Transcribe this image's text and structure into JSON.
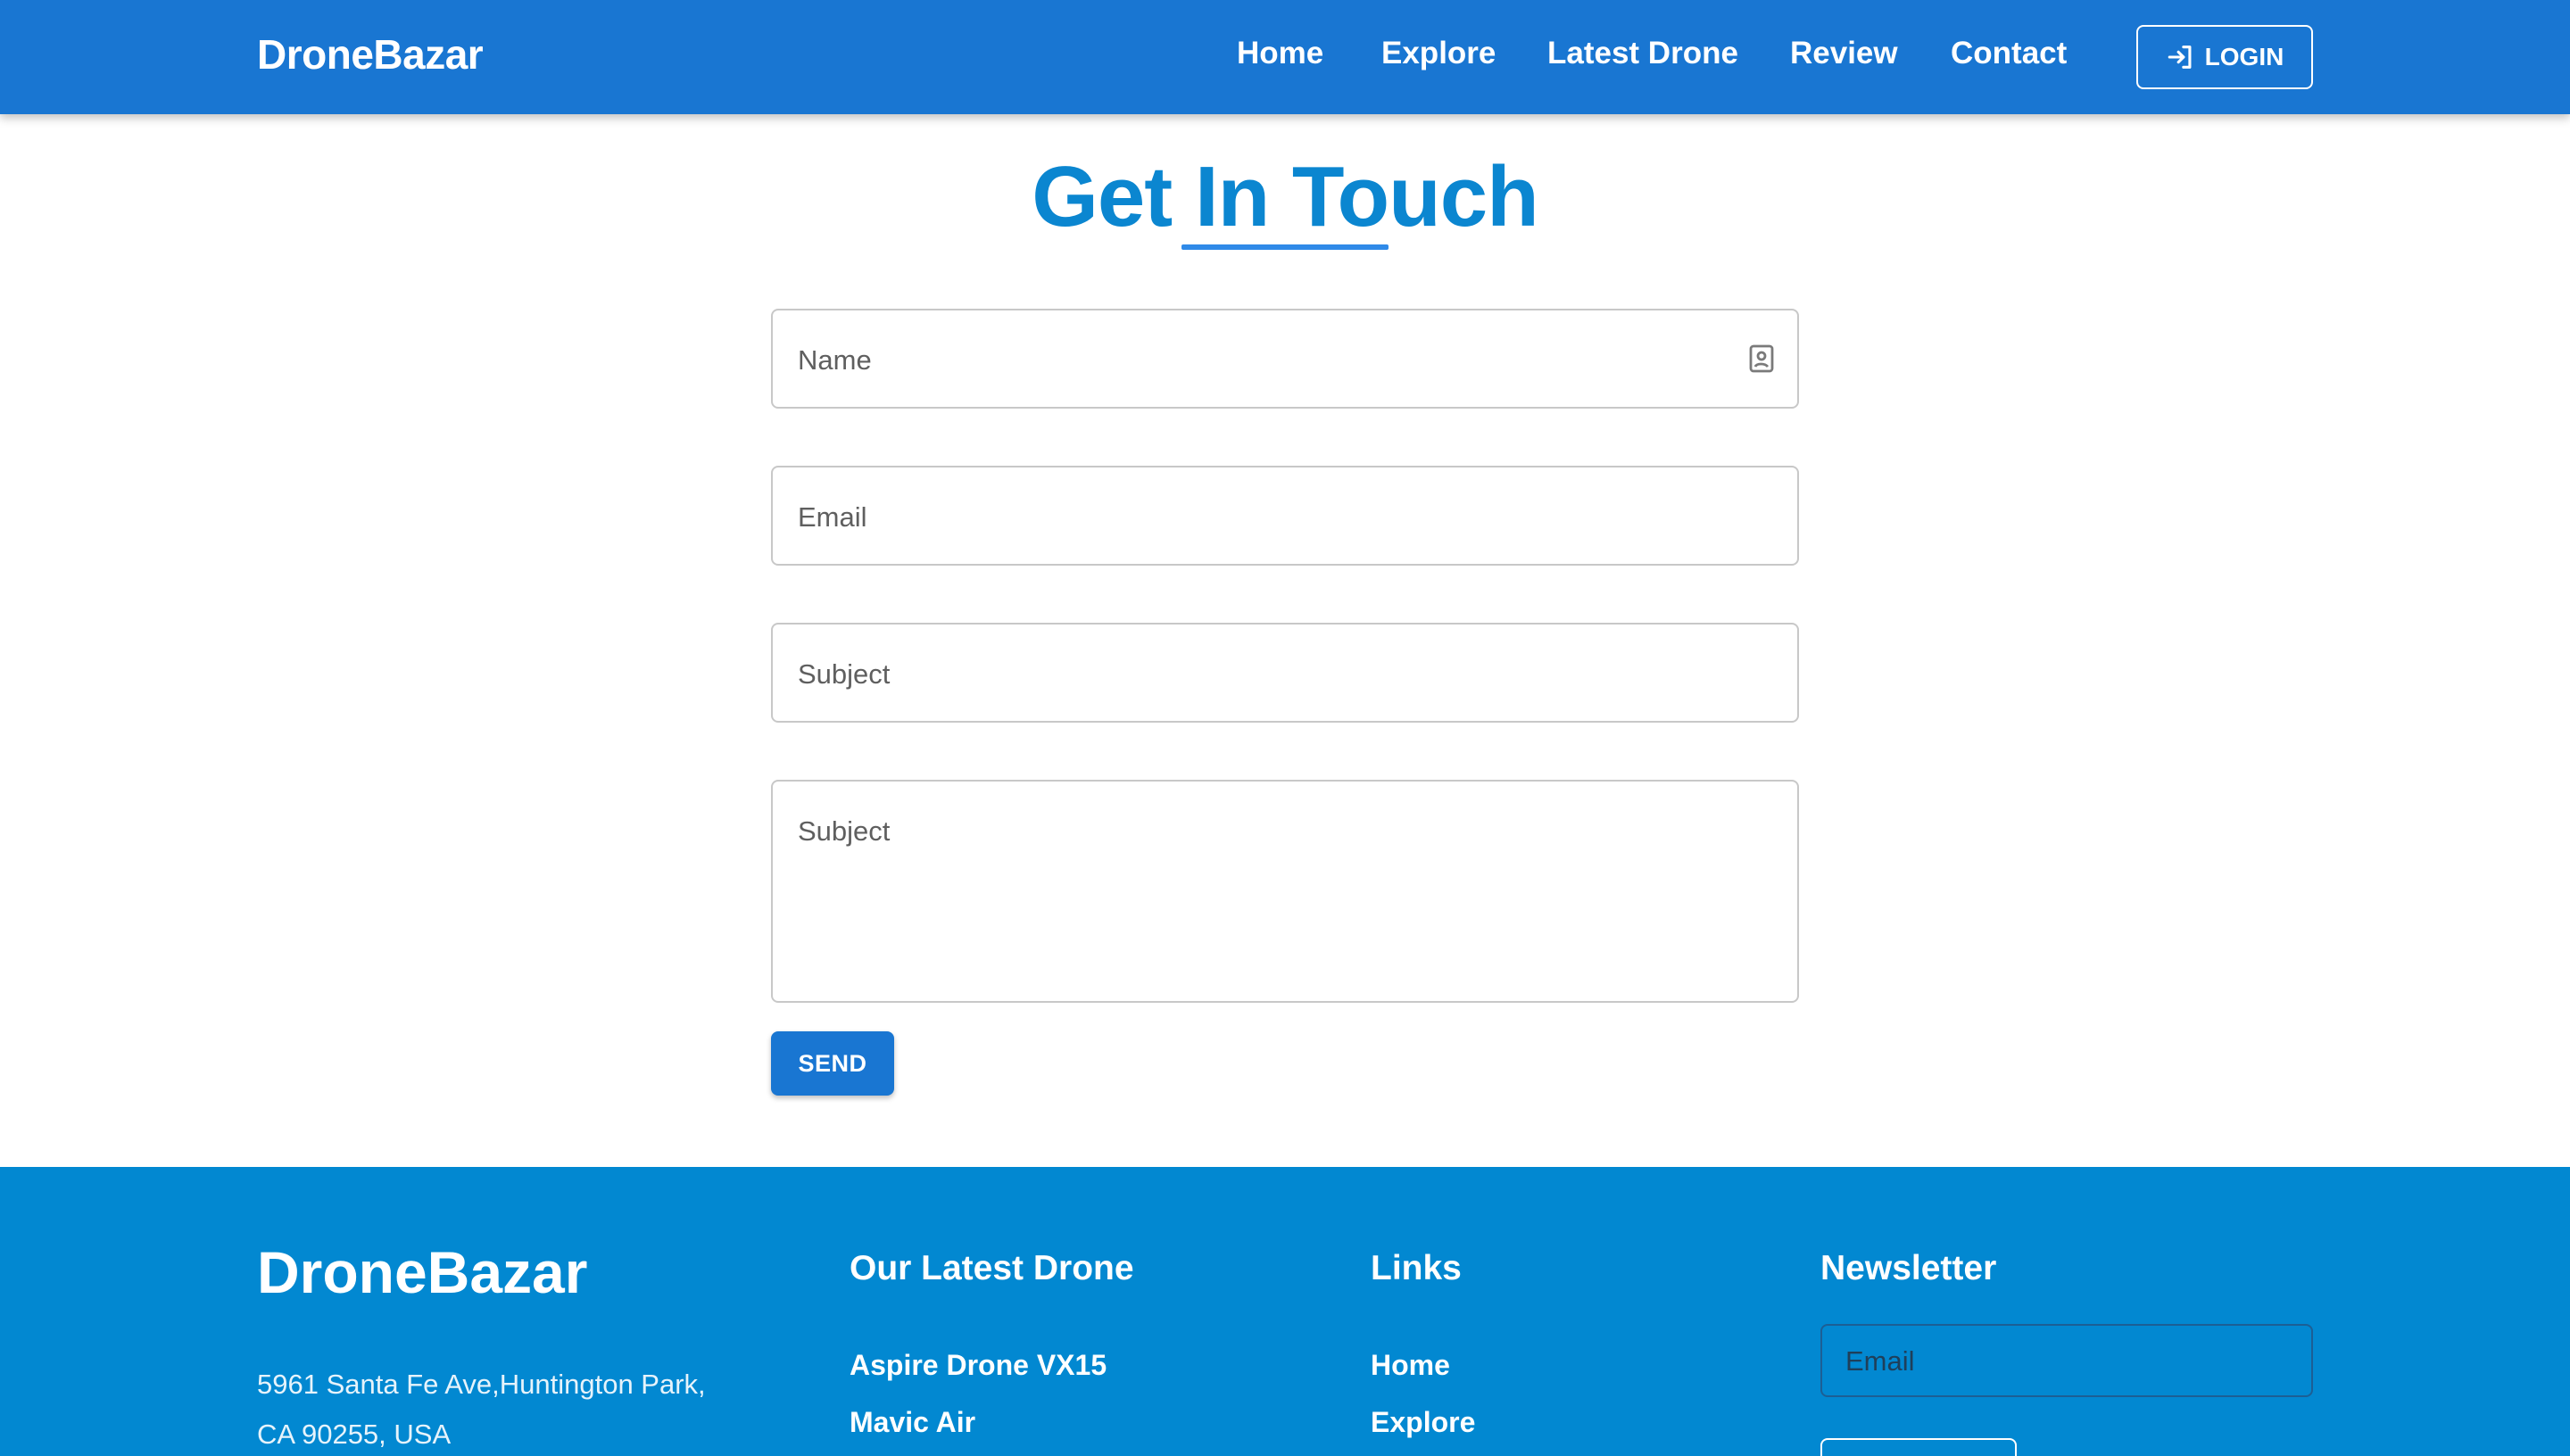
{
  "header": {
    "brand": "DroneBazar",
    "nav": [
      "Home",
      "Explore",
      "Latest Drone",
      "Review",
      "Contact"
    ],
    "login_label": "LOGIN"
  },
  "main": {
    "title": "Get In Touch",
    "form": {
      "name_label": "Name",
      "email_label": "Email",
      "subject_label": "Subject",
      "message_label": "Subject",
      "send_label": "SEND"
    }
  },
  "footer": {
    "brand": "DroneBazar",
    "address_line1": "5961 Santa Fe Ave,Huntington Park,",
    "address_line2": "CA 90255, USA",
    "latest_heading": "Our Latest Drone",
    "latest_items": [
      "Aspire Drone VX15",
      "Mavic Air"
    ],
    "links_heading": "Links",
    "links_items": [
      "Home",
      "Explore"
    ],
    "newsletter_heading": "Newsletter",
    "newsletter_placeholder": "Email"
  },
  "colors": {
    "header_bg": "#1976d2",
    "title": "#0b86d0",
    "footer_bg": "#0288d1",
    "button": "#1976d2"
  },
  "icons": {
    "login": "login-icon",
    "name_field": "contact-card-icon"
  }
}
